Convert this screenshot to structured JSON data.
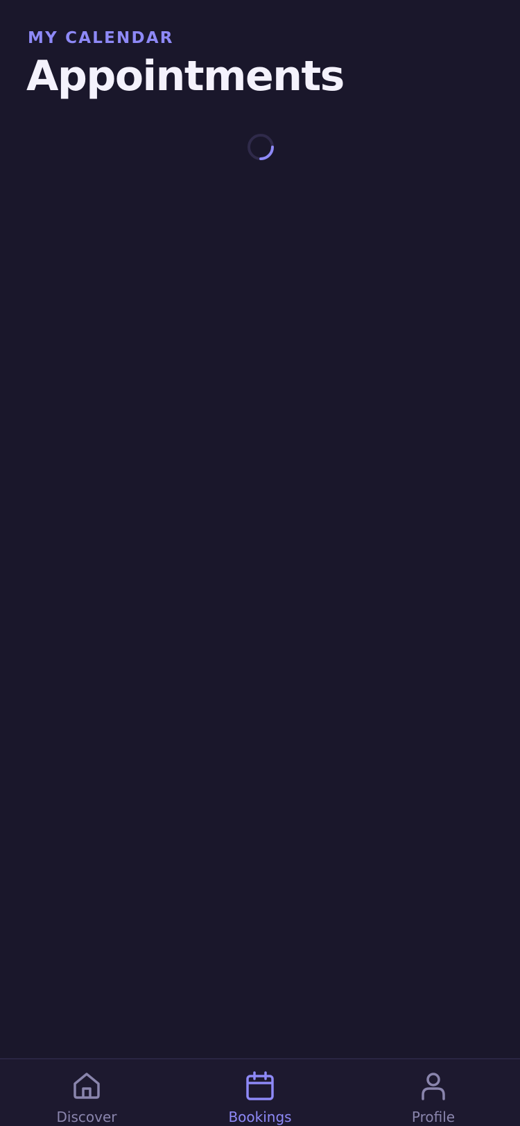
{
  "header": {
    "eyebrow": "MY CALENDAR",
    "title": "Appointments"
  },
  "loading": {
    "icon": "loading-spinner-icon"
  },
  "tabbar": {
    "active": "Bookings",
    "tabs": [
      {
        "label": "Discover",
        "icon": "home-icon"
      },
      {
        "label": "Bookings",
        "icon": "calendar-icon"
      },
      {
        "label": "Profile",
        "icon": "user-icon"
      }
    ]
  },
  "colors": {
    "background": "#1a172b",
    "tabbar_background": "#1d192f",
    "accent": "#8e89f7",
    "title_text": "#f4f2fc",
    "inactive": "#8a85ad"
  }
}
